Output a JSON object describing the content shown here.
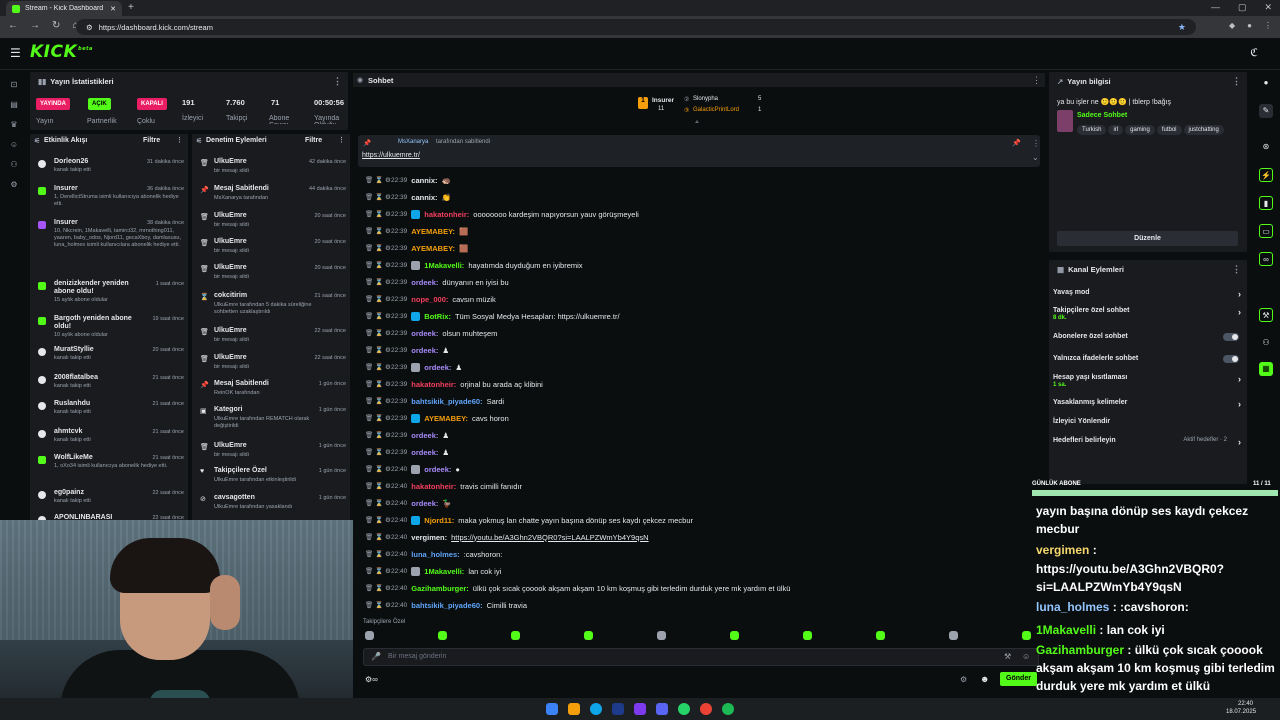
{
  "browser": {
    "tab_title": "Stream - Kick Dashboard",
    "url": "https://dashboard.kick.com/stream"
  },
  "header": {
    "logo": "KICK",
    "logo_sup": "beta"
  },
  "stats": {
    "title": "Yayın İstatistikleri",
    "badges": [
      {
        "label": "YAYINDA",
        "color": "#e91e63"
      },
      {
        "label": "AÇIK",
        "color": "#53fc18"
      },
      {
        "label": "KAPALI",
        "color": "#e91e63"
      }
    ],
    "labels": [
      "Yayın",
      "Partnerlik",
      "Çoklu"
    ],
    "values": [
      "191",
      "7.760",
      "71",
      "00:50:56"
    ],
    "value_labels": [
      "İzleyici",
      "Takipçi",
      "Abone Sayısı",
      "Yayında Olduğu"
    ]
  },
  "activity": {
    "title": "Etkinlik Akışı",
    "filter": "Filtre",
    "items": [
      {
        "name": "Dorleon26",
        "sub": "kanalı takip etti",
        "time": "31 dakika önce"
      },
      {
        "name": "Insurer",
        "sub": "1, DerellictStruma isimli kullanıcıya abonelik hediye etti.",
        "time": "36 dakika önce"
      },
      {
        "name": "Insurer",
        "sub": "10, Nkcrein, 1Makavelli, tamirci32, mrnothing011, yaaren, baby_odos, Njord11, gecaXboy, damlasusu, luna_holmes isimli kullanıcılara abonelik hediye etti.",
        "time": "38 dakika önce"
      },
      {
        "name": "denizizkender yeniden abone oldu!",
        "sub": "15 aylık abone oldular",
        "time": "1 saat önce"
      },
      {
        "name": "Bargoth yeniden abone oldu!",
        "sub": "10 aylık abone oldular",
        "time": "19 saat önce"
      },
      {
        "name": "MuratStyllie",
        "sub": "kanalı takip etti",
        "time": "20 saat önce"
      },
      {
        "name": "2008flatalbea",
        "sub": "kanalı takip etti",
        "time": "21 saat önce"
      },
      {
        "name": "Ruslanhdu",
        "sub": "kanalı takip etti",
        "time": "21 saat önce"
      },
      {
        "name": "ahmtcvk",
        "sub": "kanalı takip etti",
        "time": "21 saat önce"
      },
      {
        "name": "WolfLikeMe",
        "sub": "1, oXo34 isimli kullanıcıya abonelik hediye etti.",
        "time": "21 saat önce"
      },
      {
        "name": "eg0painz",
        "sub": "kanalı takip etti",
        "time": "22 saat önce"
      },
      {
        "name": "APONLINBARASI",
        "sub": "",
        "time": "22 saat önce"
      }
    ]
  },
  "moderation": {
    "title": "Denetim Eylemleri",
    "filter": "Filtre",
    "items": [
      {
        "name": "UlkuEmre",
        "sub": "bir mesajı sildi",
        "time": "42 dakika önce"
      },
      {
        "name": "Mesaj Sabitlendi",
        "sub": "MsXanarya tarafından",
        "time": "44 dakika önce"
      },
      {
        "name": "UlkuEmre",
        "sub": "bir mesajı sildi",
        "time": "20 saat önce"
      },
      {
        "name": "UlkuEmre",
        "sub": "bir mesajı sildi",
        "time": "20 saat önce"
      },
      {
        "name": "UlkuEmre",
        "sub": "bir mesajı sildi",
        "time": "20 saat önce"
      },
      {
        "name": "cokcitirim",
        "sub": "UlkuEmre tarafından 5 dakika süreliğine sohbetten uzaklaştırıldı",
        "time": "21 saat önce"
      },
      {
        "name": "UlkuEmre",
        "sub": "bir mesajı sildi",
        "time": "22 saat önce"
      },
      {
        "name": "UlkuEmre",
        "sub": "bir mesajı sildi",
        "time": "22 saat önce"
      },
      {
        "name": "Mesaj Sabitlendi",
        "sub": "ReinOK tarafından",
        "time": "1 gün önce"
      },
      {
        "name": "Kategori",
        "sub": "UlkuEmre tarafından REMATCH olarak değiştirildi",
        "time": "1 gün önce"
      },
      {
        "name": "UlkuEmre",
        "sub": "bir mesajı sildi",
        "time": "1 gün önce"
      },
      {
        "name": "Takipçilere Özel",
        "sub": "UlkuEmre tarafından etkinleştirildi",
        "time": "1 gün önce"
      },
      {
        "name": "cavsagotten",
        "sub": "UlkuEmre tarafından yasaklandı",
        "time": "1 gün önce"
      }
    ]
  },
  "chat": {
    "title": "Sohbet",
    "leaderboard": [
      {
        "name": "Insurer",
        "value": "11"
      },
      {
        "name": "Slonypha",
        "value": "5"
      },
      {
        "name": "GalacticPrintLord",
        "value": "1"
      }
    ],
    "pinned": {
      "by": "MsXanarya",
      "by_suffix": "tarafından sabitlendi",
      "link": "https://ulkuemre.tr/"
    },
    "messages": [
      {
        "time": "22:39",
        "user": "cannix:",
        "color": "#e5e7eb",
        "text": "🦔"
      },
      {
        "time": "22:39",
        "user": "cannix:",
        "color": "#e5e7eb",
        "text": "👏"
      },
      {
        "time": "22:39",
        "user": "hakatonheir:",
        "color": "#f43f5e",
        "text": "oooooooo kardeşim napıyorsun yauv görüşmeyeli"
      },
      {
        "time": "22:39",
        "user": "AYEMABEY:",
        "color": "#f59e0b",
        "text": "🟫"
      },
      {
        "time": "22:39",
        "user": "AYEMABEY:",
        "color": "#f59e0b",
        "text": "🟫"
      },
      {
        "time": "22:39",
        "user": "1Makavelli:",
        "color": "#53fc18",
        "text": "hayatımda duyduğum en iyibremix"
      },
      {
        "time": "22:39",
        "user": "ordeek:",
        "color": "#a78bfa",
        "text": "dünyanın en iyisi bu"
      },
      {
        "time": "22:39",
        "user": "nope_000:",
        "color": "#f43f5e",
        "text": "cavsın müzik"
      },
      {
        "time": "22:39",
        "user": "BotRix:",
        "color": "#53fc18",
        "text": "Tüm Sosyal Medya Hesapları: https://ulkuemre.tr/"
      },
      {
        "time": "22:39",
        "user": "ordeek:",
        "color": "#a78bfa",
        "text": "olsun muhteşem"
      },
      {
        "time": "22:39",
        "user": "ordeek:",
        "color": "#a78bfa",
        "text": "♟"
      },
      {
        "time": "22:39",
        "user": "ordeek:",
        "color": "#a78bfa",
        "text": "♟"
      },
      {
        "time": "22:39",
        "user": "hakatonheir:",
        "color": "#f43f5e",
        "text": "orjinal bu arada aç klibini"
      },
      {
        "time": "22:39",
        "user": "bahtsikik_piyade60:",
        "color": "#60a5fa",
        "text": "Sardi"
      },
      {
        "time": "22:39",
        "user": "AYEMABEY:",
        "color": "#f59e0b",
        "text": "cavs horon"
      },
      {
        "time": "22:39",
        "user": "ordeek:",
        "color": "#a78bfa",
        "text": "♟"
      },
      {
        "time": "22:39",
        "user": "ordeek:",
        "color": "#a78bfa",
        "text": "♟"
      },
      {
        "time": "22:40",
        "user": "ordeek:",
        "color": "#a78bfa",
        "text": "●"
      },
      {
        "time": "22:40",
        "user": "hakatonheir:",
        "color": "#f43f5e",
        "text": "travis cimilli fanıdır"
      },
      {
        "time": "22:40",
        "user": "ordeek:",
        "color": "#a78bfa",
        "text": "🦆"
      },
      {
        "time": "22:40",
        "user": "Njord11:",
        "color": "#f59e0b",
        "text": "maka yokmuş lan chatte yayın başına dönüp ses kaydı çekcez mecbur"
      },
      {
        "time": "22:40",
        "user": "vergimen:",
        "color": "#e5e7eb",
        "text": "https://youtu.be/A3Ghn2VBQR0?si=LAALPZWmYb4Y9qsN"
      },
      {
        "time": "22:40",
        "user": "luna_holmes:",
        "color": "#60a5fa",
        "text": ":cavshoron:"
      },
      {
        "time": "22:40",
        "user": "1Makavelli:",
        "color": "#53fc18",
        "text": "lan cok iyi"
      },
      {
        "time": "22:40",
        "user": "Gazihamburger:",
        "color": "#53fc18",
        "text": "ülkü çok sıcak çooook akşam akşam 10 km koşmuş gibi terledim durduk yere mk yardım et ülkü"
      },
      {
        "time": "22:40",
        "user": "bahtsikik_piyade60:",
        "color": "#60a5fa",
        "text": "Cimilli travia"
      }
    ],
    "followers_only": "Takipçilere Özel",
    "input_placeholder": "Bir mesaj gönderin",
    "send": "Gönder"
  },
  "stream_info": {
    "title": "Yayın bilgisi",
    "stream_title": "ya bu işler ne 🙂🙂🙂 | tblerp !bağış",
    "category": "Sadece Sohbet",
    "tags": [
      "Turkish",
      "irl",
      "gaming",
      "futbol",
      "justchatting"
    ],
    "edit": "Düzenle"
  },
  "channel_actions": {
    "title": "Kanal Eylemleri",
    "items": [
      {
        "label": "Yavaş mod",
        "control": "chevron",
        "sub": ""
      },
      {
        "label": "Takipçilere özel sohbet",
        "control": "chevron",
        "sub": "8 dk."
      },
      {
        "label": "Abonelere özel sohbet",
        "control": "toggle",
        "sub": ""
      },
      {
        "label": "Yalnızca ifadelerle sohbet",
        "control": "toggle",
        "sub": ""
      },
      {
        "label": "Hesap yaşı kısıtlaması",
        "control": "chevron",
        "sub": "1 sa."
      },
      {
        "label": "Yasaklanmış kelimeler",
        "control": "chevron",
        "sub": ""
      },
      {
        "label": "İzleyici Yönlendir",
        "control": "none",
        "sub": ""
      },
      {
        "label": "Hedefleri belirleyin",
        "control": "chevron",
        "sub": "",
        "extra": "Aktif hedefler · 2"
      }
    ]
  },
  "overlay": {
    "goal_label": "GÜNLÜK ABONE",
    "goal_count": "11 / 11",
    "goal_progress": 1.0,
    "lines": [
      {
        "user": "",
        "text": "yayın başına dönüp ses kaydı çekcez",
        "color": "#ffffff"
      },
      {
        "user": "",
        "text": "mecbur",
        "color": "#ffffff"
      },
      {
        "user": "vergimen",
        "text": " :",
        "color": "#f5d76e"
      },
      {
        "user": "",
        "text": "https://youtu.be/A3Ghn2VBQR0?",
        "color": "#ffffff"
      },
      {
        "user": "",
        "text": "si=LAALPZWmYb4Y9qsN",
        "color": "#ffffff"
      },
      {
        "user": "luna_holmes",
        "text": " : :cavshoron:",
        "color": "#93c5fd"
      },
      {
        "user": "1Makavelli",
        "text": " : lan cok iyi",
        "color": "#53fc18"
      },
      {
        "user": "Gazihamburger",
        "text": " : ülkü çok sıcak çooook",
        "color": "#53fc18"
      },
      {
        "user": "",
        "text": "akşam akşam 10 km koşmuş gibi terledim",
        "color": "#ffffff"
      },
      {
        "user": "",
        "text": "durduk yere mk yardım et ülkü",
        "color": "#ffffff"
      },
      {
        "user": "bahtsikik_piyade60",
        "text": " : Cimilli travia",
        "color": "#93c5fd"
      }
    ]
  },
  "taskbar": {
    "time": "22:40",
    "date": "18.07.2025"
  },
  "colors": {
    "accent": "#53fc18",
    "live": "#e91e63",
    "panel": "#191b1f",
    "bg": "#0b0e0f"
  }
}
